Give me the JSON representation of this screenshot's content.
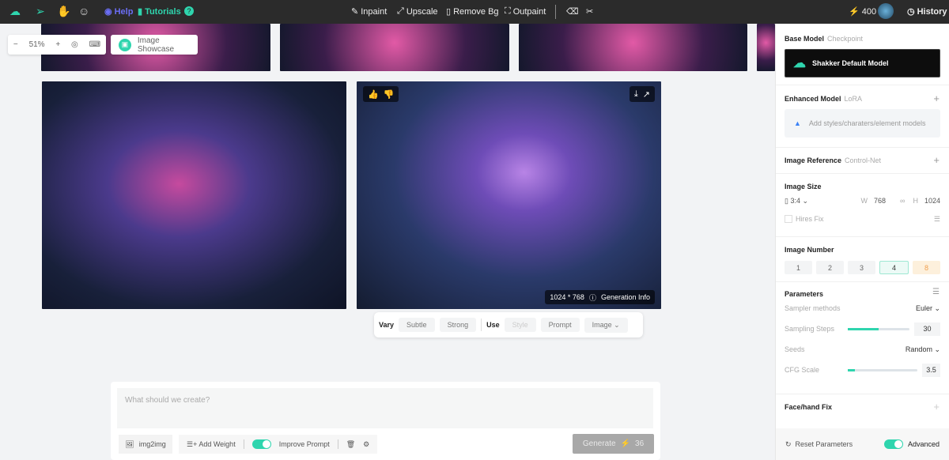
{
  "topbar": {
    "help": "Help",
    "tutorials": "Tutorials",
    "tools": [
      "Inpaint",
      "Upscale",
      "Remove Bg",
      "Outpaint"
    ],
    "credits": "400",
    "history": "History"
  },
  "canvas": {
    "zoom": "51%",
    "showcase": "Image Showcase",
    "image_size": "1024 * 768",
    "generation_info": "Generation Info"
  },
  "vary": {
    "vary_label": "Vary",
    "subtle": "Subtle",
    "strong": "Strong",
    "use_label": "Use",
    "style": "Style",
    "prompt": "Prompt",
    "image": "Image"
  },
  "prompt": {
    "placeholder": "What should we create?",
    "img2img": "img2img",
    "add_weight": "Add Weight",
    "improve_prompt": "Improve Prompt",
    "improve_prompt_on": true,
    "generate": "Generate",
    "cost": "36"
  },
  "panel": {
    "base_model": {
      "title": "Base Model",
      "sub": "Checkpoint",
      "model": "Shakker Default Model"
    },
    "enhanced": {
      "title": "Enhanced Model",
      "sub": "LoRA",
      "placeholder": "Add styles/charaters/element models"
    },
    "reference": {
      "title": "Image Reference",
      "sub": "Control-Net"
    },
    "size": {
      "title": "Image Size",
      "ratio": "3:4",
      "w_label": "W",
      "w": "768",
      "h_label": "H",
      "h": "1024",
      "hires": "Hires Fix"
    },
    "number": {
      "title": "Image Number",
      "options": [
        "1",
        "2",
        "3",
        "4",
        "8"
      ],
      "selected": "4"
    },
    "params": {
      "title": "Parameters",
      "sampler_label": "Sampler methods",
      "sampler": "Euler",
      "steps_label": "Sampling Steps",
      "steps": "30",
      "steps_fill": 0.5,
      "seeds_label": "Seeds",
      "seeds": "Random",
      "cfg_label": "CFG Scale",
      "cfg": "3.5",
      "cfg_fill": 0.1
    },
    "face": {
      "title": "Face/hand Fix"
    },
    "reset": "Reset Parameters",
    "advanced": "Advanced",
    "advanced_on": true
  },
  "colors": {
    "accent": "#2fd5ae",
    "topbar": "#2b2b2b",
    "help": "#6b6ef5"
  }
}
